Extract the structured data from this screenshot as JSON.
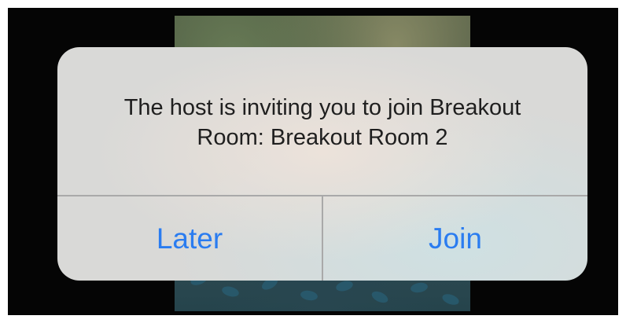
{
  "dialog": {
    "message": "The host is inviting you to join Breakout Room: Breakout Room 2",
    "message_line1": "The host is inviting you to join Breakout",
    "message_line2": "Room: Breakout Room 2",
    "later_label": "Later",
    "join_label": "Join"
  },
  "colors": {
    "accent": "#2a7cf0",
    "background": "#050505",
    "dialog": "#d9d9d7"
  }
}
